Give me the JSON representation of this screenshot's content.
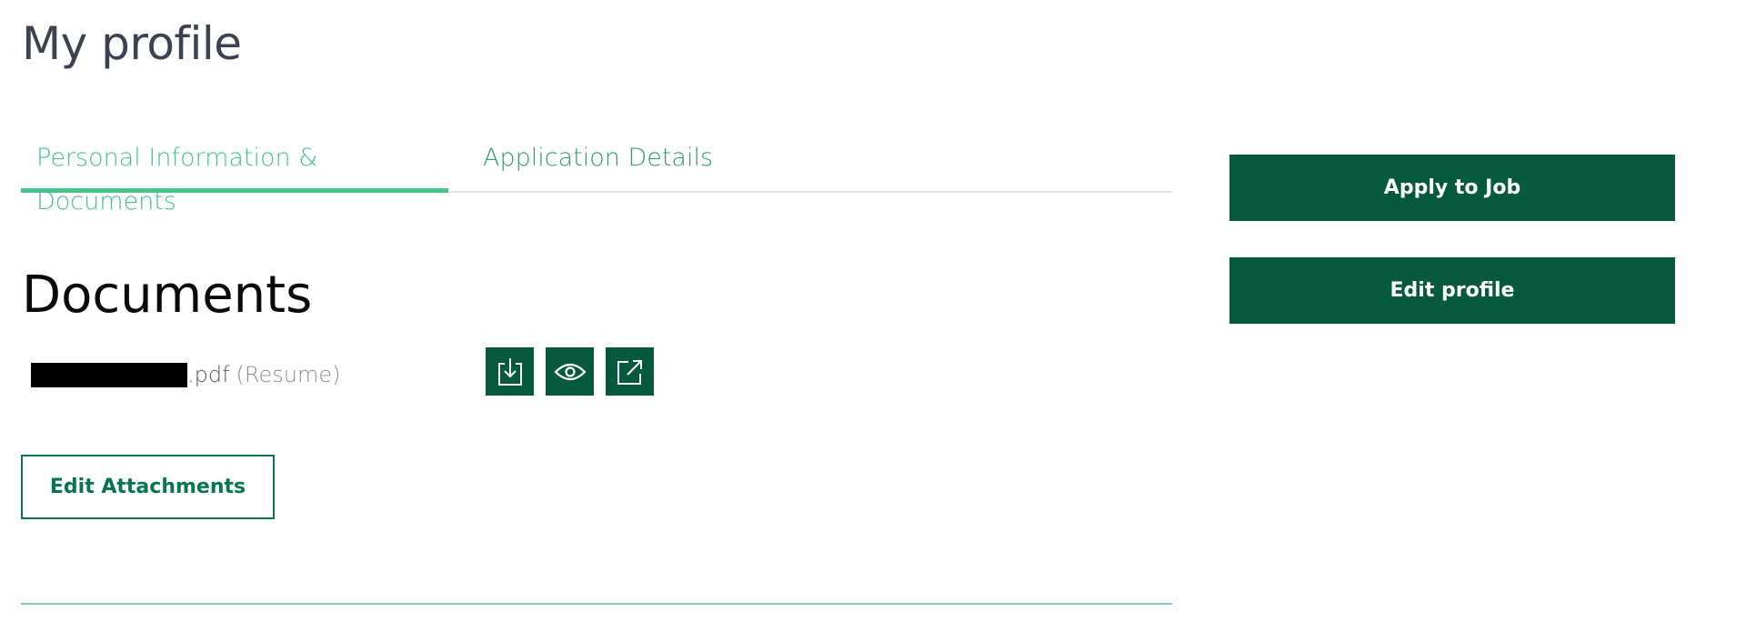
{
  "page": {
    "title": "My profile"
  },
  "tabs": [
    {
      "label": "Personal Information & Documents",
      "active": true
    },
    {
      "label": "Application Details",
      "active": false
    }
  ],
  "documents": {
    "heading": "Documents",
    "items": [
      {
        "filename_redacted": true,
        "extension": ".pdf",
        "type_label": "(Resume)",
        "actions": [
          "download-icon",
          "eye-icon",
          "external-link-icon"
        ]
      }
    ],
    "edit_attachments_label": "Edit Attachments"
  },
  "sidebar": {
    "apply_label": "Apply to Job",
    "edit_profile_label": "Edit profile"
  },
  "colors": {
    "primary": "#055a3d",
    "accent": "#44c38a",
    "tab_text": "#2f9e69",
    "title_text": "#3d4250"
  }
}
